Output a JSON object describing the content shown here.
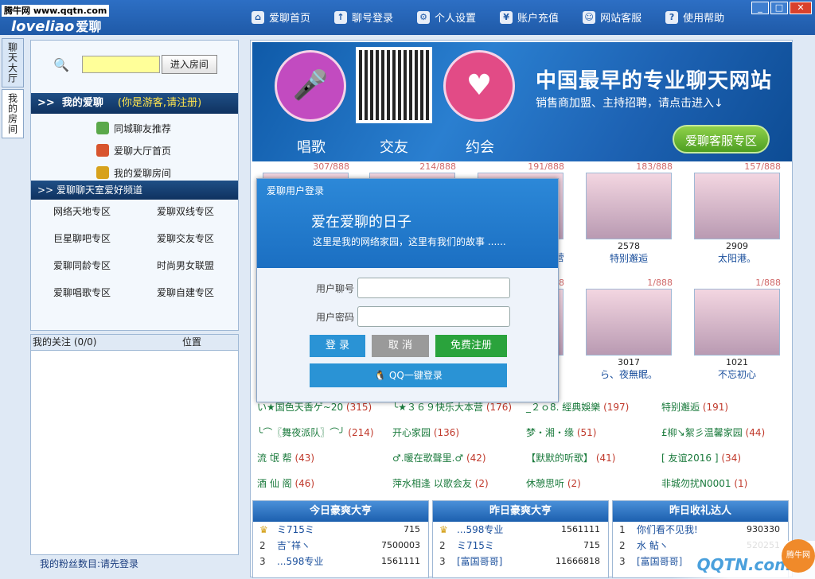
{
  "site_tag": "腾牛网 www.qqtn.com",
  "logo": {
    "en": "loveliao",
    "cn": "爱聊"
  },
  "nav": [
    {
      "label": "爱聊首页",
      "icon": "home-icon",
      "glyph": "⌂"
    },
    {
      "label": "聊号登录",
      "icon": "login-icon",
      "glyph": "↑"
    },
    {
      "label": "个人设置",
      "icon": "gear-icon",
      "glyph": "⚙"
    },
    {
      "label": "账户充值",
      "icon": "recharge-icon",
      "glyph": "¥"
    },
    {
      "label": "网站客服",
      "icon": "service-icon",
      "glyph": "☺"
    },
    {
      "label": "使用帮助",
      "icon": "help-icon",
      "glyph": "?"
    }
  ],
  "vtabs": [
    "聊天大厅",
    "我的房间"
  ],
  "search": {
    "button": "进入房间"
  },
  "my": {
    "title": "我的爱聊",
    "hint": "(你是游客,请注册)",
    "items": [
      "同城聊友推荐",
      "爱聊大厅首页",
      "我的爱聊房间"
    ]
  },
  "channels": {
    "title": "爱聊聊天室爱好频道",
    "items": [
      "网络天地专区",
      "爱聊双线专区",
      "巨星聊吧专区",
      "爱聊交友专区",
      "爱聊同龄专区",
      "时尚男女联盟",
      "爱聊唱歌专区",
      "爱聊自建专区"
    ]
  },
  "follow": {
    "title": "我的关注 (0/0)",
    "col2": "位置"
  },
  "fans": "我的粉丝数目:请先登录",
  "banner": {
    "sing": "唱歌",
    "friend": "交友",
    "date": "约会",
    "title": "中国最早的专业聊天网站",
    "sub": "销售商加盟、主持招聘，请点击进入↓",
    "service": "爱聊客服专区"
  },
  "cards_top": [
    {
      "count": "307/888",
      "num": "",
      "name": ""
    },
    {
      "count": "214/888",
      "num": "",
      "name": ""
    },
    {
      "count": "191/888",
      "num": "",
      "name": "营"
    },
    {
      "count": "183/888",
      "num": "2578",
      "name": "特别邂逅"
    },
    {
      "count": "157/888",
      "num": "2909",
      "name": "太阳港。"
    }
  ],
  "cards_bottom": [
    {
      "count": "8",
      "num": "",
      "name": ""
    },
    {
      "count": "1/888",
      "num": "3017",
      "name": "ら、夜無眠。"
    },
    {
      "count": "1/888",
      "num": "1021",
      "name": "不忘初心"
    }
  ],
  "rooms": [
    {
      "name": "い★国色天香ゲ~20",
      "n": "(315)"
    },
    {
      "name": "╰★３６９快乐大本营",
      "n": "(176)"
    },
    {
      "name": "_２ｏ8. 經典娛樂",
      "n": "(197)"
    },
    {
      "name": "特别邂逅",
      "n": "(191)"
    },
    {
      "name": "╰⌒〖舞夜派队〗⌒╯",
      "n": "(214)"
    },
    {
      "name": "开心家园",
      "n": "(136)"
    },
    {
      "name": "梦・湘・缘",
      "n": "(51)"
    },
    {
      "name": "£柳↘絮彡温馨家园",
      "n": "(44)"
    },
    {
      "name": "流 氓 帮",
      "n": "(43)"
    },
    {
      "name": "♂.暖在歌聲里.♂",
      "n": "(42)"
    },
    {
      "name": "【默默的听歌】",
      "n": "(41)"
    },
    {
      "name": "[ 友谊2016 ]",
      "n": "(34)"
    },
    {
      "name": "酒 仙 阁",
      "n": "(46)"
    },
    {
      "name": "萍水相逢 以歌会友",
      "n": "(2)"
    },
    {
      "name": "休憩思听",
      "n": "(2)"
    },
    {
      "name": "非城勿扰N0001",
      "n": "(1)"
    }
  ],
  "ranks": [
    {
      "title": "今日豪爽大亨",
      "rows": [
        {
          "i": "♛",
          "name": "ミ715ミ",
          "v": "715"
        },
        {
          "i": "2",
          "name": "吉ˇ祥ヽ",
          "v": "7500003"
        },
        {
          "i": "3",
          "name": "...598专业",
          "v": "1561111"
        }
      ]
    },
    {
      "title": "昨日豪爽大亨",
      "rows": [
        {
          "i": "♛",
          "name": "...598专业",
          "v": "1561111"
        },
        {
          "i": "2",
          "name": "ミ715ミ",
          "v": "715"
        },
        {
          "i": "3",
          "name": "[富国哥哥]",
          "v": "11666818"
        }
      ]
    },
    {
      "title": "昨日收礼达人",
      "rows": [
        {
          "i": "1",
          "name": "你们看不见我!",
          "v": "930330"
        },
        {
          "i": "2",
          "name": "水 鲇ヽ",
          "v": "520251"
        },
        {
          "i": "3",
          "name": "[富国哥哥]",
          "v": ""
        }
      ]
    }
  ],
  "modal": {
    "title": "爱聊用户登录",
    "heading": "爱在爱聊的日子",
    "sub": "这里是我的网络家园，这里有我们的故事 ......",
    "user_label": "用户聊号",
    "pass_label": "用户密码",
    "login": "登 录",
    "cancel": "取 消",
    "register": "免费注册",
    "qq": "QQ一键登录"
  },
  "watermark": {
    "text": "QQTN.com",
    "ball": "腾牛网"
  }
}
